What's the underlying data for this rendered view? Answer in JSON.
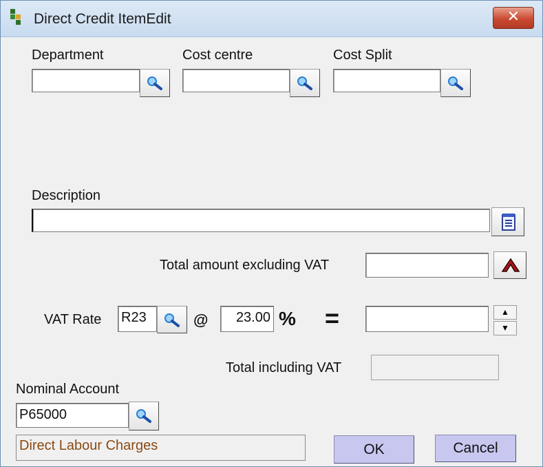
{
  "window": {
    "title": "Direct Credit ItemEdit"
  },
  "fields": {
    "department": {
      "label": "Department",
      "value": ""
    },
    "cost_centre": {
      "label": "Cost centre",
      "value": ""
    },
    "cost_split": {
      "label": "Cost Split",
      "value": ""
    },
    "description": {
      "label": "Description",
      "value": ""
    },
    "total_excl_vat": {
      "label": "Total amount excluding VAT",
      "value": ""
    },
    "vat": {
      "label": "VAT Rate",
      "code": "R23",
      "at_symbol": "@",
      "rate": "23.00",
      "percent_symbol": "%",
      "equals_symbol": "=",
      "amount": ""
    },
    "total_incl_vat": {
      "label": "Total including VAT",
      "value": ""
    },
    "nominal_account": {
      "label": "Nominal Account",
      "value": "P65000",
      "description": "Direct Labour Charges"
    }
  },
  "spinner": {
    "up": "▲",
    "down": "▼"
  },
  "buttons": {
    "ok": "OK",
    "cancel": "Cancel",
    "close": "✕"
  },
  "colors": {
    "button_face": "#c7c7f0",
    "account_text": "#8a4a12",
    "close_button": "#cb4a32"
  },
  "icons": {
    "lookup": "magnifier-icon",
    "notes": "notepad-icon",
    "calc": "caret-up-icon",
    "app": "app-logo-icon"
  }
}
